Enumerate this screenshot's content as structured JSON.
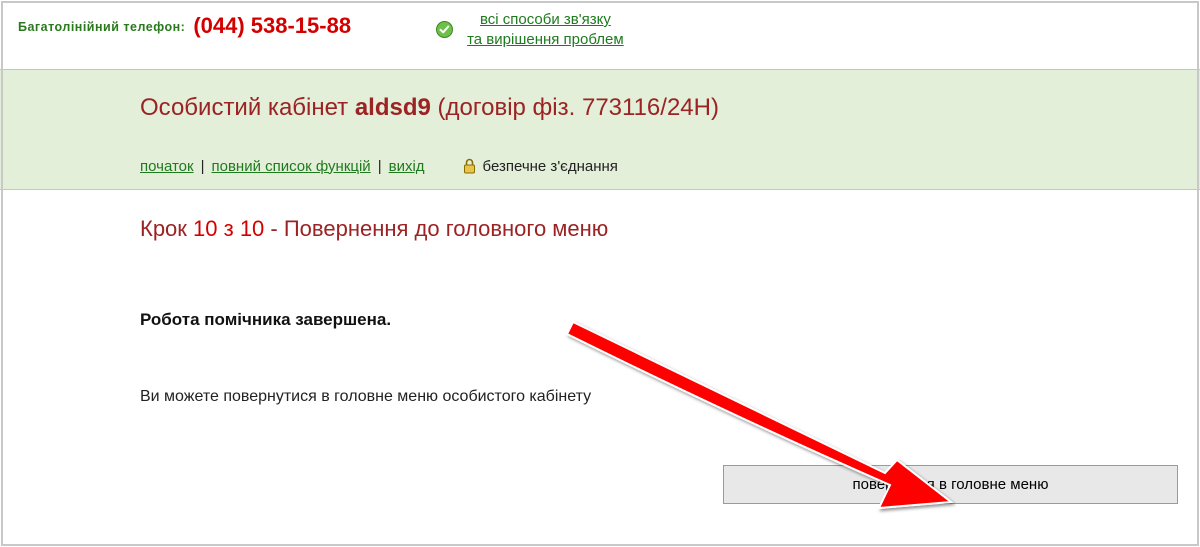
{
  "topbar": {
    "phone_label": "Багатолінійний телефон:",
    "phone_number": "(044) 538-15-88",
    "contact_line1": "всі способи зв'язку",
    "contact_line2": "та вирішення проблем"
  },
  "header": {
    "title_prefix": "Особистий кабінет ",
    "username": "aldsd9",
    "title_suffix": " (договір фіз. 773116/24Н)",
    "nav": {
      "home": "початок",
      "full_list": "повний список функцій",
      "exit": "вихід"
    },
    "secure_label": "безпечне з'єднання"
  },
  "content": {
    "step_word": "Крок ",
    "step_num": "10 з 10",
    "step_sep": " - ",
    "step_title": "Повернення до головного меню",
    "completed": "Робота помічника завершена.",
    "return_hint": "Ви можете повернутися в головне меню особистого кабінету",
    "return_button": "повернення в головне меню"
  },
  "colors": {
    "brand_green": "#1f7a1f",
    "brand_red": "#d40000",
    "dark_red": "#9b2323",
    "panel_bg": "#e3efd9"
  }
}
